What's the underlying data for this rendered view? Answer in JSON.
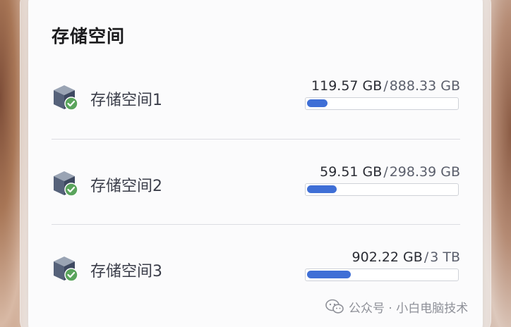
{
  "panel": {
    "title": "存储空间"
  },
  "storage_pools": [
    {
      "name": "存储空间1",
      "used": "119.57 GB",
      "separator": "/",
      "total": "888.33 GB",
      "usage_fraction": 0.135,
      "status_icon": "check-circle-icon"
    },
    {
      "name": "存储空间2",
      "used": "59.51 GB",
      "separator": "/",
      "total": "298.39 GB",
      "usage_fraction": 0.199,
      "status_icon": "check-circle-icon"
    },
    {
      "name": "存储空间3",
      "used": "902.22 GB",
      "separator": "/",
      "total": "3 TB",
      "usage_fraction": 0.294,
      "status_icon": "check-circle-icon"
    }
  ],
  "watermark": {
    "text": "公众号 · 小白电脑技术",
    "icon": "wechat-icon"
  },
  "colors": {
    "accent": "#3f6fd6",
    "status_ok": "#5aa45c"
  }
}
